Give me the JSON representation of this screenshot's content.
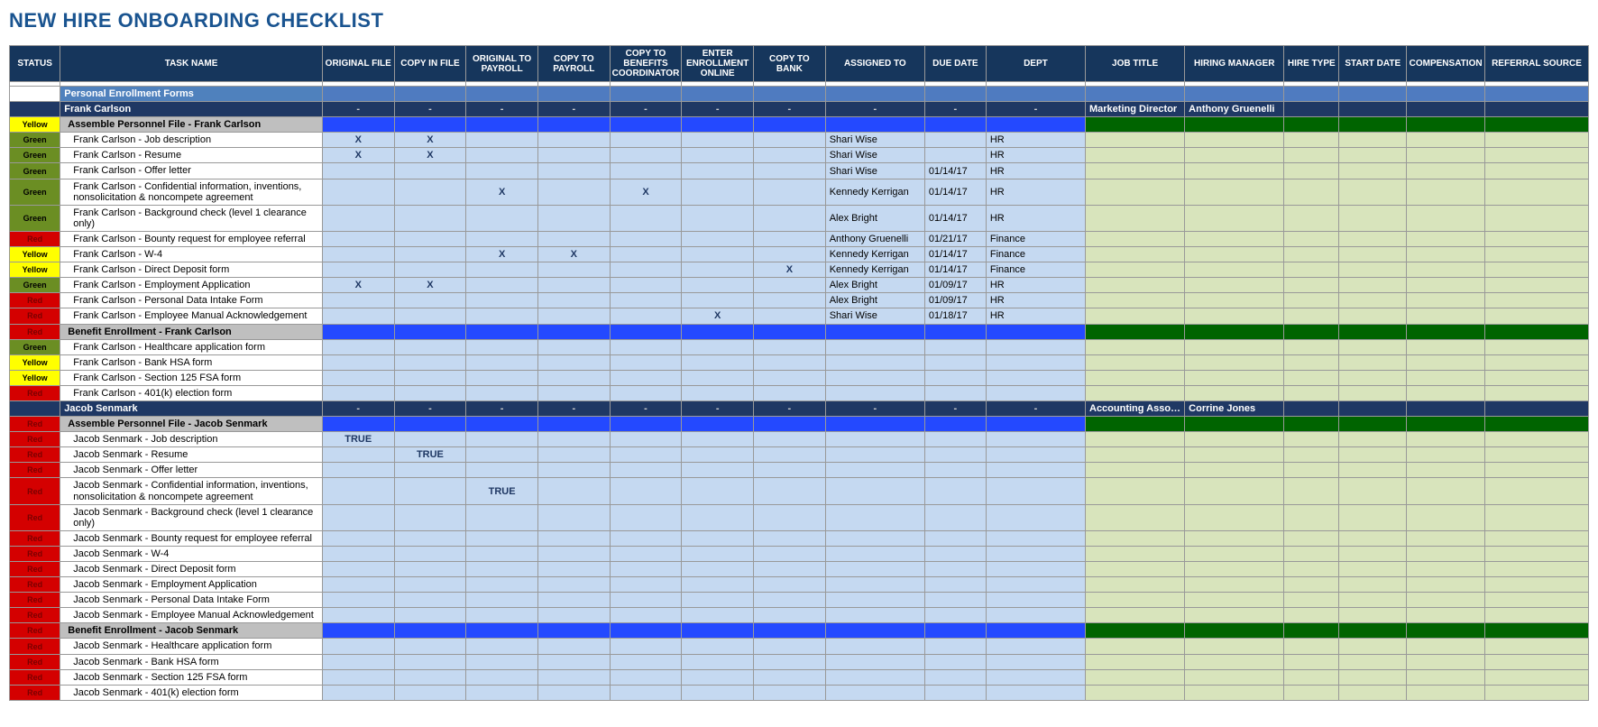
{
  "title": "NEW HIRE ONBOARDING CHECKLIST",
  "columns": [
    "STATUS",
    "TASK NAME",
    "ORIGINAL FILE",
    "COPY IN FILE",
    "ORIGINAL TO PAYROLL",
    "COPY TO PAYROLL",
    "COPY TO BENEFITS COORDINATOR",
    "ENTER ENROLLMENT ONLINE",
    "COPY TO BANK",
    "ASSIGNED TO",
    "DUE DATE",
    "DEPT",
    "JOB TITLE",
    "HIRING MANAGER",
    "HIRE TYPE",
    "START DATE",
    "COMPENSATION",
    "REFERRAL SOURCE"
  ],
  "rows": [
    {
      "type": "blank-first"
    },
    {
      "type": "section",
      "task": "Personal Enrollment Forms"
    },
    {
      "type": "person",
      "task": "Frank Carlson",
      "job": "Marketing Director",
      "mgr": "Anthony Gruenelli"
    },
    {
      "type": "subheader",
      "status": "Yellow",
      "task": "Assemble Personnel File - Frank Carlson"
    },
    {
      "type": "task",
      "status": "Green",
      "task": "Frank Carlson - Job description",
      "x": [
        "X",
        "X",
        "",
        "",
        "",
        "",
        ""
      ],
      "assigned": "Shari Wise",
      "due": "",
      "dept": "HR"
    },
    {
      "type": "task",
      "status": "Green",
      "task": "Frank Carlson - Resume",
      "x": [
        "X",
        "X",
        "",
        "",
        "",
        "",
        ""
      ],
      "assigned": "Shari Wise",
      "due": "",
      "dept": "HR"
    },
    {
      "type": "task",
      "status": "Green",
      "task": "Frank Carlson - Offer letter",
      "x": [
        "",
        "",
        "",
        "",
        "",
        "",
        ""
      ],
      "assigned": "Shari Wise",
      "due": "01/14/17",
      "dept": "HR"
    },
    {
      "type": "task",
      "status": "Green",
      "task": "Frank Carlson - Confidential information, inventions, nonsolicitation & noncompete agreement",
      "x": [
        "",
        "",
        "X",
        "",
        "X",
        "",
        ""
      ],
      "assigned": "Kennedy Kerrigan",
      "due": "01/14/17",
      "dept": "HR"
    },
    {
      "type": "task",
      "status": "Green",
      "task": "Frank Carlson - Background check (level 1 clearance only)",
      "x": [
        "",
        "",
        "",
        "",
        "",
        "",
        ""
      ],
      "assigned": "Alex Bright",
      "due": "01/14/17",
      "dept": "HR"
    },
    {
      "type": "task",
      "status": "Red",
      "task": "Frank Carlson - Bounty request for employee referral",
      "x": [
        "",
        "",
        "",
        "",
        "",
        "",
        ""
      ],
      "assigned": "Anthony Gruenelli",
      "due": "01/21/17",
      "dept": "Finance"
    },
    {
      "type": "task",
      "status": "Yellow",
      "task": "Frank Carlson - W-4",
      "x": [
        "",
        "",
        "X",
        "X",
        "",
        "",
        ""
      ],
      "assigned": "Kennedy Kerrigan",
      "due": "01/14/17",
      "dept": "Finance"
    },
    {
      "type": "task",
      "status": "Yellow",
      "task": "Frank Carlson - Direct Deposit form",
      "x": [
        "",
        "",
        "",
        "",
        "",
        "",
        "X"
      ],
      "assigned": "Kennedy Kerrigan",
      "due": "01/14/17",
      "dept": "Finance"
    },
    {
      "type": "task",
      "status": "Green",
      "task": "Frank Carlson - Employment Application",
      "x": [
        "X",
        "X",
        "",
        "",
        "",
        "",
        ""
      ],
      "assigned": "Alex Bright",
      "due": "01/09/17",
      "dept": "HR"
    },
    {
      "type": "task",
      "status": "Red",
      "task": "Frank Carlson - Personal Data Intake Form",
      "x": [
        "",
        "",
        "",
        "",
        "",
        "",
        ""
      ],
      "assigned": "Alex Bright",
      "due": "01/09/17",
      "dept": "HR"
    },
    {
      "type": "task",
      "status": "Red",
      "task": "Frank Carlson - Employee Manual Acknowledgement",
      "x": [
        "",
        "",
        "",
        "",
        "",
        "X",
        ""
      ],
      "assigned": "Shari Wise",
      "due": "01/18/17",
      "dept": "HR"
    },
    {
      "type": "subheader",
      "status": "Red",
      "task": "Benefit Enrollment - Frank Carlson"
    },
    {
      "type": "task",
      "status": "Green",
      "task": "Frank Carlson - Healthcare application form",
      "x": [
        "",
        "",
        "",
        "",
        "",
        "",
        ""
      ],
      "assigned": "",
      "due": "",
      "dept": ""
    },
    {
      "type": "task",
      "status": "Yellow",
      "task": "Frank Carlson - Bank HSA form",
      "x": [
        "",
        "",
        "",
        "",
        "",
        "",
        ""
      ],
      "assigned": "",
      "due": "",
      "dept": ""
    },
    {
      "type": "task",
      "status": "Yellow",
      "task": "Frank Carlson - Section 125 FSA form",
      "x": [
        "",
        "",
        "",
        "",
        "",
        "",
        ""
      ],
      "assigned": "",
      "due": "",
      "dept": ""
    },
    {
      "type": "task",
      "status": "Red",
      "task": "Frank Carlson - 401(k) election form",
      "x": [
        "",
        "",
        "",
        "",
        "",
        "",
        ""
      ],
      "assigned": "",
      "due": "",
      "dept": ""
    },
    {
      "type": "person",
      "task": "Jacob Senmark",
      "job": "Accounting Associate",
      "mgr": "Corrine Jones"
    },
    {
      "type": "subheader",
      "status": "Red",
      "task": "Assemble Personnel File - Jacob Senmark"
    },
    {
      "type": "task",
      "status": "Red",
      "task": "Jacob Senmark - Job description",
      "x": [
        "TRUE",
        "",
        "",
        "",
        "",
        "",
        ""
      ],
      "assigned": "",
      "due": "",
      "dept": ""
    },
    {
      "type": "task",
      "status": "Red",
      "task": "Jacob Senmark - Resume",
      "x": [
        "",
        "TRUE",
        "",
        "",
        "",
        "",
        ""
      ],
      "assigned": "",
      "due": "",
      "dept": ""
    },
    {
      "type": "task",
      "status": "Red",
      "task": "Jacob Senmark - Offer letter",
      "x": [
        "",
        "",
        "",
        "",
        "",
        "",
        ""
      ],
      "assigned": "",
      "due": "",
      "dept": ""
    },
    {
      "type": "task",
      "status": "Red",
      "task": "Jacob Senmark - Confidential information, inventions, nonsolicitation & noncompete agreement",
      "x": [
        "",
        "",
        "TRUE",
        "",
        "",
        "",
        ""
      ],
      "assigned": "",
      "due": "",
      "dept": ""
    },
    {
      "type": "task",
      "status": "Red",
      "task": "Jacob Senmark - Background check (level 1 clearance only)",
      "x": [
        "",
        "",
        "",
        "",
        "",
        "",
        ""
      ],
      "assigned": "",
      "due": "",
      "dept": ""
    },
    {
      "type": "task",
      "status": "Red",
      "task": "Jacob Senmark - Bounty request for employee referral",
      "x": [
        "",
        "",
        "",
        "",
        "",
        "",
        ""
      ],
      "assigned": "",
      "due": "",
      "dept": ""
    },
    {
      "type": "task",
      "status": "Red",
      "task": "Jacob Senmark - W-4",
      "x": [
        "",
        "",
        "",
        "",
        "",
        "",
        ""
      ],
      "assigned": "",
      "due": "",
      "dept": ""
    },
    {
      "type": "task",
      "status": "Red",
      "task": "Jacob Senmark - Direct Deposit form",
      "x": [
        "",
        "",
        "",
        "",
        "",
        "",
        ""
      ],
      "assigned": "",
      "due": "",
      "dept": ""
    },
    {
      "type": "task",
      "status": "Red",
      "task": "Jacob Senmark - Employment Application",
      "x": [
        "",
        "",
        "",
        "",
        "",
        "",
        ""
      ],
      "assigned": "",
      "due": "",
      "dept": ""
    },
    {
      "type": "task",
      "status": "Red",
      "task": "Jacob Senmark - Personal Data Intake Form",
      "x": [
        "",
        "",
        "",
        "",
        "",
        "",
        ""
      ],
      "assigned": "",
      "due": "",
      "dept": ""
    },
    {
      "type": "task",
      "status": "Red",
      "task": "Jacob Senmark - Employee Manual Acknowledgement",
      "x": [
        "",
        "",
        "",
        "",
        "",
        "",
        ""
      ],
      "assigned": "",
      "due": "",
      "dept": ""
    },
    {
      "type": "subheader",
      "status": "Red",
      "task": "Benefit Enrollment - Jacob Senmark"
    },
    {
      "type": "task",
      "status": "Red",
      "task": "Jacob Senmark - Healthcare application form",
      "x": [
        "",
        "",
        "",
        "",
        "",
        "",
        ""
      ],
      "assigned": "",
      "due": "",
      "dept": ""
    },
    {
      "type": "task",
      "status": "Red",
      "task": "Jacob Senmark - Bank HSA form",
      "x": [
        "",
        "",
        "",
        "",
        "",
        "",
        ""
      ],
      "assigned": "",
      "due": "",
      "dept": ""
    },
    {
      "type": "task",
      "status": "Red",
      "task": "Jacob Senmark - Section 125 FSA form",
      "x": [
        "",
        "",
        "",
        "",
        "",
        "",
        ""
      ],
      "assigned": "",
      "due": "",
      "dept": ""
    },
    {
      "type": "task",
      "status": "Red",
      "task": "Jacob Senmark - 401(k) election form",
      "x": [
        "",
        "",
        "",
        "",
        "",
        "",
        ""
      ],
      "assigned": "",
      "due": "",
      "dept": ""
    }
  ]
}
